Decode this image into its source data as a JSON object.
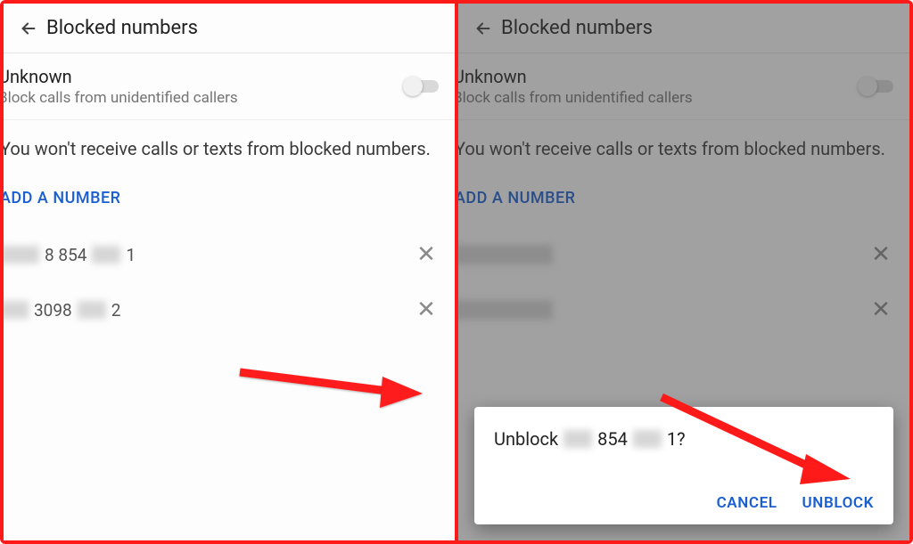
{
  "header": {
    "title": "Blocked numbers"
  },
  "unknown": {
    "title": "Unknown",
    "subtitle": "Block calls from unidentified callers"
  },
  "info_text": "You won't receive calls or texts from blocked numbers.",
  "add_label": "ADD A NUMBER",
  "numbers": [
    {
      "mid": "8 854",
      "suffix": "1"
    },
    {
      "seg": "3098",
      "suffix": "2"
    }
  ],
  "dialog": {
    "prefix": "Unblock",
    "mid": "854",
    "suffix": "1?",
    "cancel": "CANCEL",
    "unblock": "UNBLOCK"
  }
}
